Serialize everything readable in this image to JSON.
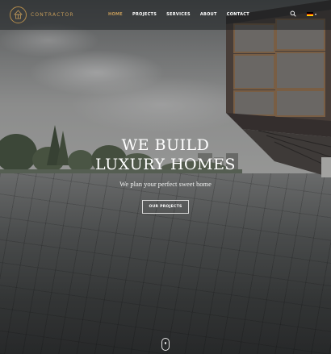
{
  "header": {
    "logo_text": "CONTRACTOR",
    "nav": [
      {
        "label": "HOME",
        "active": true
      },
      {
        "label": "PROJECTS",
        "active": false
      },
      {
        "label": "SERVICES",
        "active": false
      },
      {
        "label": "ABOUT",
        "active": false
      },
      {
        "label": "CONTACT",
        "active": false
      }
    ],
    "language": "de"
  },
  "hero": {
    "headline_line1": "WE BUILD",
    "headline_line2": "LUXURY HOMES",
    "subline": "We plan your perfect sweet home",
    "cta_label": "OUR PROJECTS"
  },
  "colors": {
    "accent": "#c49b5a",
    "text": "#ffffff"
  },
  "icons": {
    "search": "search-icon",
    "scroll": "mouse-scroll-icon"
  }
}
